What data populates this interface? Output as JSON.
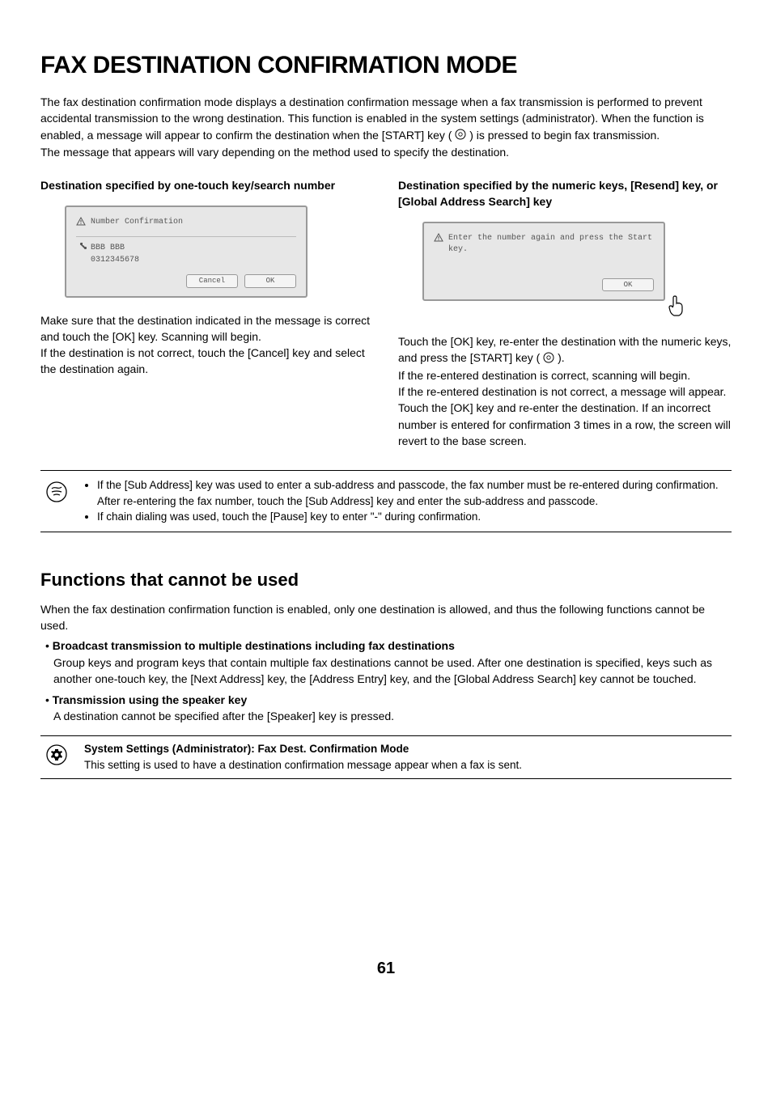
{
  "title": "FAX DESTINATION CONFIRMATION MODE",
  "intro_p1": "The fax destination confirmation mode displays a destination confirmation message when a fax transmission is performed to prevent accidental transmission to the wrong destination. This function is enabled in the system settings (administrator). When the function is enabled, a message will appear to confirm the destination when the [START] key (",
  "intro_p2": ") is pressed to begin fax transmission.",
  "intro_p3": "The message that appears will vary depending on the method used to specify the destination.",
  "left": {
    "heading": "Destination specified by one-touch key/search number",
    "dialog": {
      "title": "Number Confirmation",
      "name": "BBB BBB",
      "number": "0312345678",
      "cancel": "Cancel",
      "ok": "OK"
    },
    "body1": "Make sure that the destination indicated in the message is correct and touch the [OK] key. Scanning will begin.",
    "body2": "If the destination is not correct, touch the [Cancel] key and select the destination again."
  },
  "right": {
    "heading": "Destination specified by the numeric keys, [Resend] key, or [Global Address Search] key",
    "dialog": {
      "msg": "Enter the number again and press the Start key.",
      "ok": "OK"
    },
    "body1a": "Touch the [OK] key, re-enter the destination with the numeric keys, and press the [START] key (",
    "body1b": ").",
    "body2": "If the re-entered destination is correct, scanning will begin.",
    "body3": "If the re-entered destination is not correct, a message will appear. Touch the [OK] key and re-enter the destination. If an incorrect number is entered for confirmation 3 times in a row, the screen will revert to the base screen."
  },
  "note": {
    "item1": "If the [Sub Address] key was used to enter a sub-address and passcode, the fax number must be re-entered during confirmation. After re-entering the fax number, touch the [Sub Address] key and enter the sub-address and passcode.",
    "item2": "If chain dialing was used, touch the [Pause] key to enter \"-\" during confirmation."
  },
  "functions": {
    "heading": "Functions that cannot be used",
    "intro": "When the fax destination confirmation function is enabled, only one destination is allowed, and thus the following functions cannot be used.",
    "b1_title": "Broadcast transmission to multiple destinations including fax destinations",
    "b1_body": "Group keys and program keys that contain multiple fax destinations cannot be used. After one destination is specified, keys such as another one-touch key, the [Next Address] key, the [Address Entry] key, and the [Global Address Search] key cannot be touched.",
    "b2_title": "Transmission using the speaker key",
    "b2_body": "A destination cannot be specified after the [Speaker] key is pressed."
  },
  "sys": {
    "bold": "System Settings (Administrator): Fax Dest. Confirmation Mode",
    "body": "This setting is used to have a destination confirmation message appear when a fax is sent."
  },
  "page": "61"
}
